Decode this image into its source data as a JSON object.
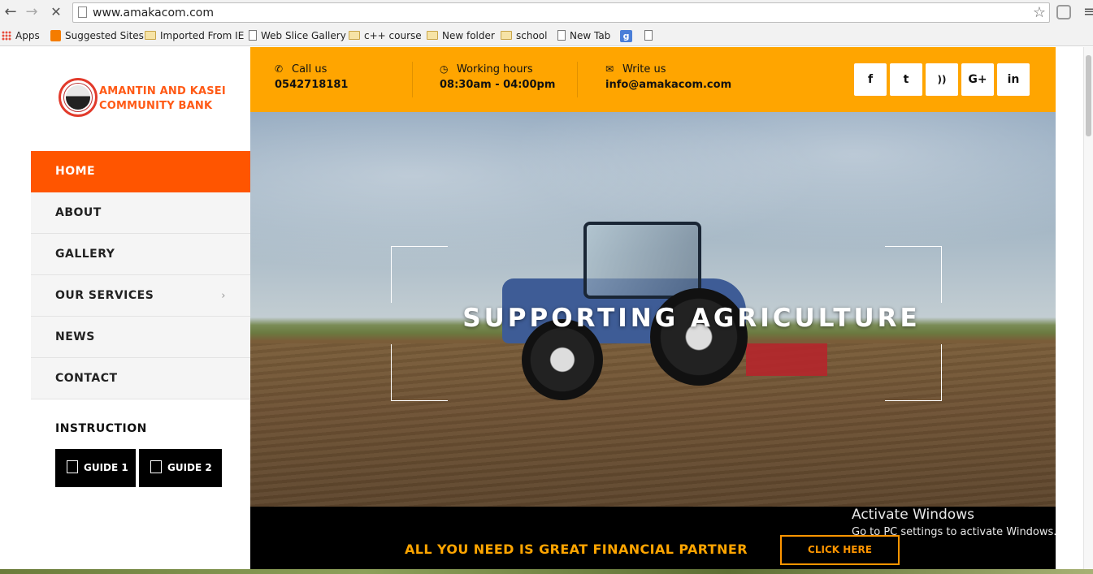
{
  "browser": {
    "url": "www.amakacom.com",
    "bookmarks": [
      "Apps",
      "Suggested Sites",
      "Imported From IE",
      "Web Slice Gallery",
      "c++ course",
      "New folder",
      "school",
      "New Tab"
    ]
  },
  "logo": {
    "line1": "AMANTIN AND KASEI",
    "line2": "COMMUNITY BANK"
  },
  "menu": {
    "items": [
      {
        "label": "HOME",
        "active": true
      },
      {
        "label": "ABOUT"
      },
      {
        "label": "GALLERY"
      },
      {
        "label": "OUR SERVICES",
        "has_submenu": true
      },
      {
        "label": "NEWS"
      },
      {
        "label": "CONTACT"
      }
    ]
  },
  "instruction": {
    "title": "INSTRUCTION",
    "guide1": "GUIDE 1",
    "guide2": "GUIDE 2"
  },
  "topbar": {
    "call": {
      "label": "Call us",
      "value": "0542718181"
    },
    "hours": {
      "label": "Working hours",
      "value": "08:30am - 04:00pm"
    },
    "write": {
      "label": "Write us",
      "value": "info@amakacom.com"
    },
    "social": [
      "f",
      "t",
      "rss",
      "G+",
      "in"
    ]
  },
  "hero": {
    "title": "SUPPORTING AGRICULTURE"
  },
  "cta": {
    "text": "ALL YOU NEED IS GREAT FINANCIAL PARTNER",
    "button": "CLICK HERE"
  },
  "watermark": {
    "line1": "Activate Windows",
    "line2": "Go to PC settings to activate Windows."
  },
  "colors": {
    "orange": "#ffa500",
    "active_menu": "#ff5500",
    "cta_bg": "#000000"
  }
}
